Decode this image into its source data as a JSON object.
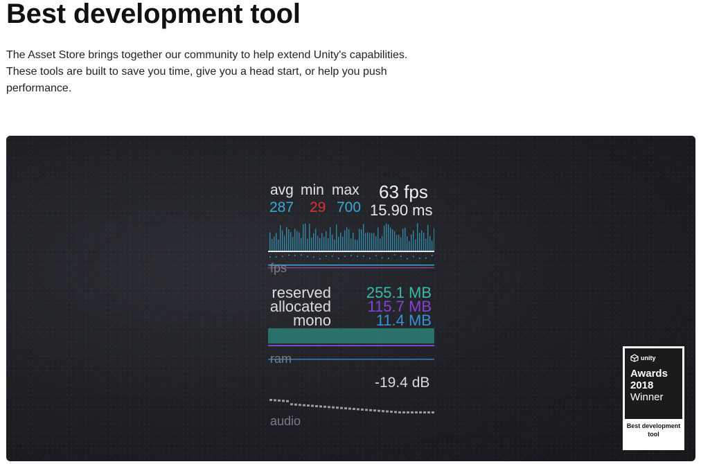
{
  "header": {
    "title": "Best development tool",
    "description": "The Asset Store brings together our community to help extend Unity's capabilities. These tools are built to save you time, give you a head start, or help you push performance."
  },
  "stats": {
    "fps_headers": [
      "avg",
      "min",
      "max"
    ],
    "fps_values": [
      {
        "text": "287",
        "color": "#39a9d6"
      },
      {
        "text": "29",
        "color": "#e0312f"
      },
      {
        "text": "700",
        "color": "#39a9d6"
      }
    ],
    "fps": "63 fps",
    "ms": "15.90 ms",
    "fps_graph_label": "fps",
    "memory": [
      {
        "label": "reserved",
        "value": "255.1 MB",
        "color": "#3bb8a9"
      },
      {
        "label": "allocated",
        "value": "115.7 MB",
        "color": "#8a3fd4"
      },
      {
        "label": "mono",
        "value": "11.4 MB",
        "color": "#3a8fd6"
      }
    ],
    "ram_graph_label": "ram",
    "audio_db": "-19.4 dB",
    "audio_graph_label": "audio"
  },
  "award": {
    "brand": "unity",
    "line1": "Awards",
    "line2": "2018",
    "line3": "Winner",
    "category": "Best development tool"
  },
  "colors": {
    "fps_bar": "#3aa7cf",
    "fps_line": "#e8e8e8",
    "fps_axis": "#39a9d6",
    "fps_axis2": "#d43db6",
    "ram_reserved": "#2c7f78",
    "ram_allocated": "#7d46c9",
    "ram_mono": "#3a7fc2",
    "audio_bar": "#cfcfcf"
  }
}
